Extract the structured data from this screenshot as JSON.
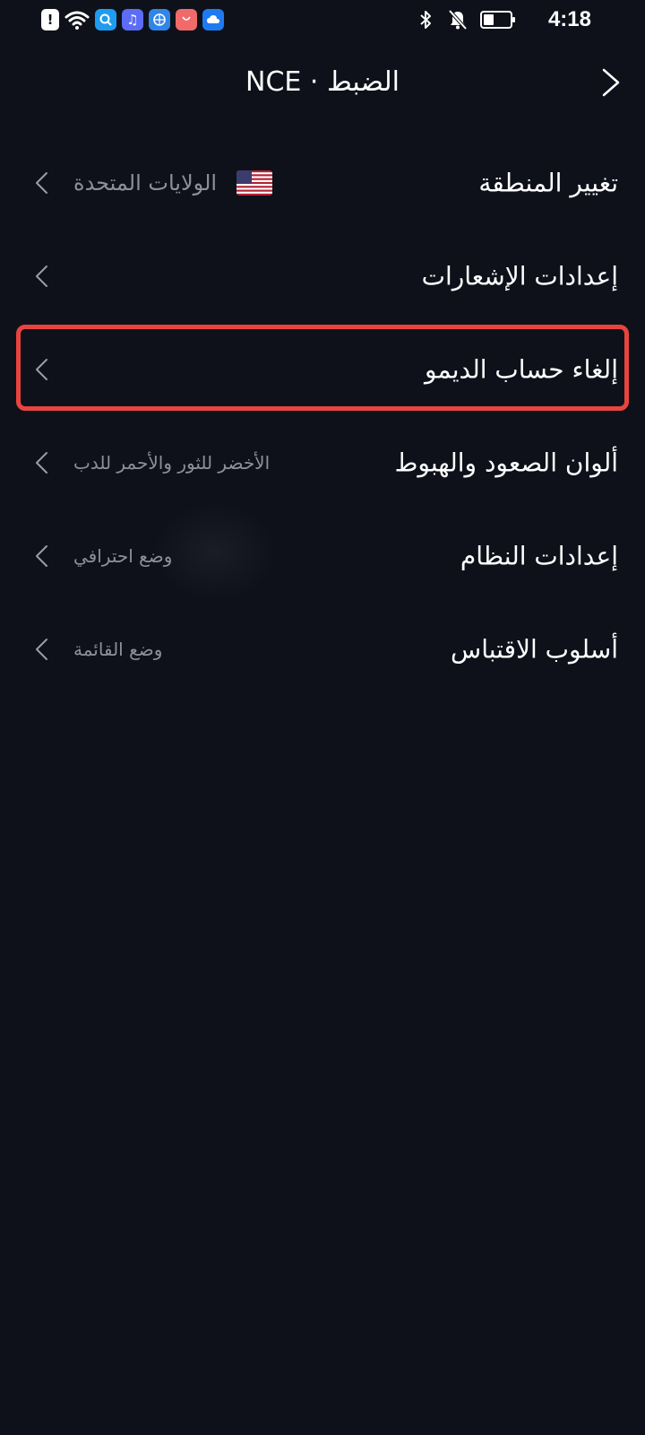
{
  "status_bar": {
    "time": "4:18",
    "battery_level": 0.4,
    "left_icons": [
      "alert-icon",
      "wifi-icon",
      "search-app-icon",
      "music-app-icon",
      "browser-app-icon",
      "shop-app-icon",
      "cloud-app-icon"
    ],
    "right_icons": [
      "bluetooth-icon",
      "bell-muted-icon",
      "battery-icon"
    ]
  },
  "header": {
    "title": "الضبط · NCE",
    "back_icon": "chevron-right-icon"
  },
  "settings": {
    "items": [
      {
        "label": "تغيير المنطقة",
        "value": "الولايات المتحدة",
        "icon": "us-flag-icon"
      },
      {
        "label": "إعدادات الإشعارات",
        "value": ""
      },
      {
        "label": "إلغاء حساب الديمو",
        "value": "",
        "highlighted": true
      },
      {
        "label": "ألوان الصعود والهبوط",
        "value": "الأخضر للثور والأحمر للدب"
      },
      {
        "label": "إعدادات النظام",
        "value": "وضع احترافي"
      },
      {
        "label": "أسلوب الاقتباس",
        "value": "وضع القائمة"
      }
    ]
  },
  "colors": {
    "background": "#0e111a",
    "text_primary": "#ffffff",
    "text_secondary": "#8d909a",
    "highlight": "#e8443f"
  }
}
